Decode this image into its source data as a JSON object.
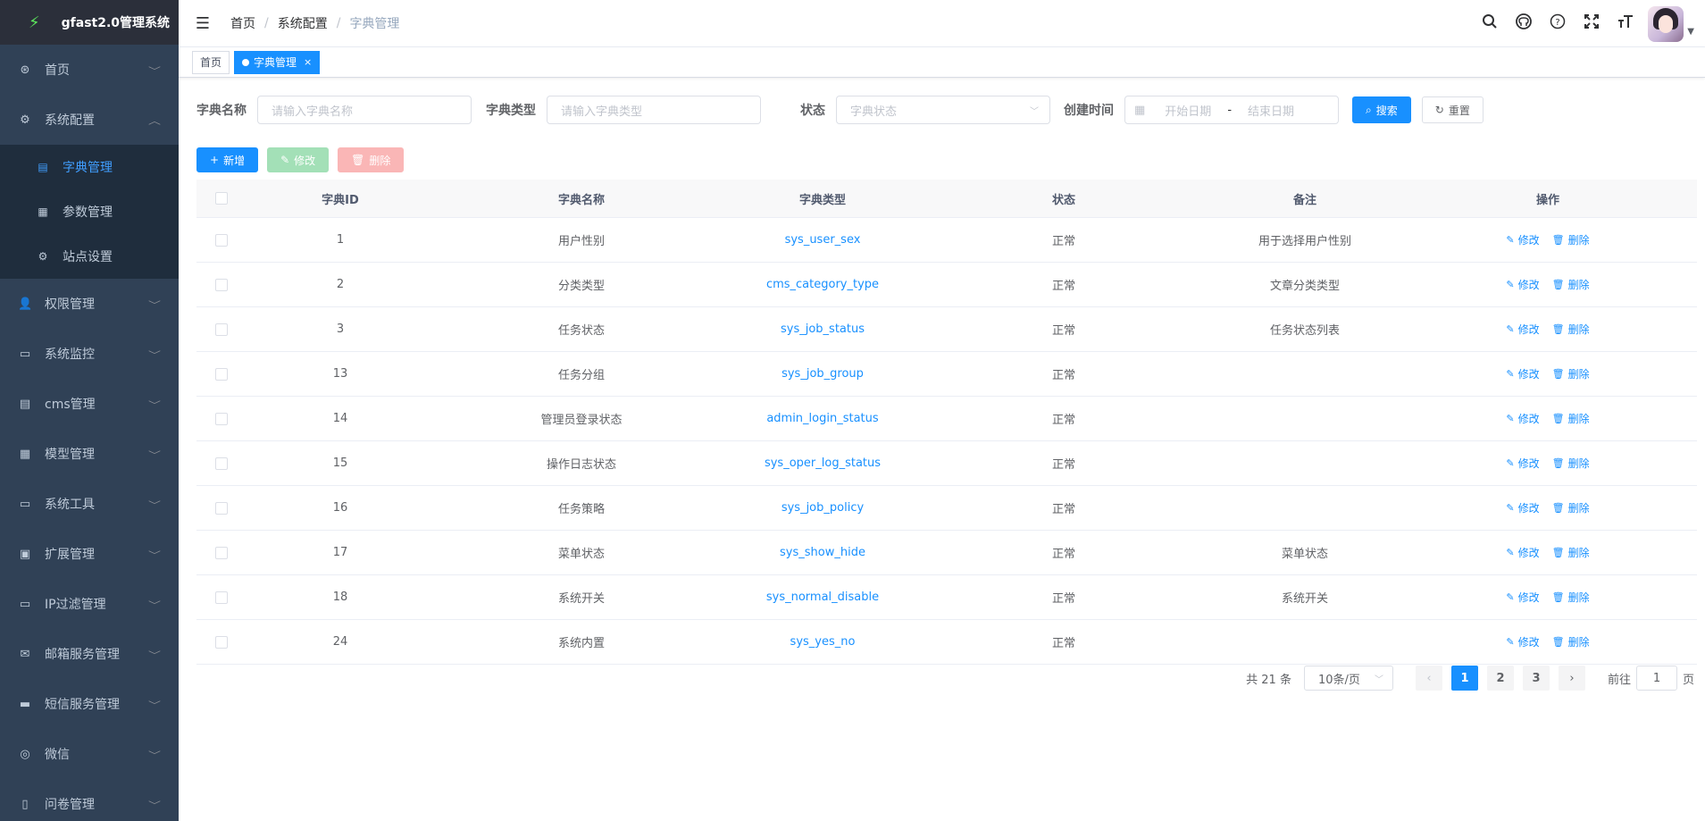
{
  "app": {
    "title": "gfast2.0管理系统"
  },
  "sidebar": {
    "items": [
      {
        "label": "首页",
        "icon": "dashboard-icon",
        "glyph": "⊛"
      },
      {
        "label": "系统配置",
        "icon": "gear-icon",
        "glyph": "⚙",
        "expanded": true,
        "children": [
          {
            "label": "字典管理",
            "icon": "dict-icon",
            "glyph": "▤",
            "active": true
          },
          {
            "label": "参数管理",
            "icon": "param-icon",
            "glyph": "▦"
          },
          {
            "label": "站点设置",
            "icon": "gear-icon",
            "glyph": "⚙"
          }
        ]
      },
      {
        "label": "权限管理",
        "icon": "user-icon",
        "glyph": "👤"
      },
      {
        "label": "系统监控",
        "icon": "monitor-icon",
        "glyph": "▭"
      },
      {
        "label": "cms管理",
        "icon": "document-icon",
        "glyph": "▤"
      },
      {
        "label": "模型管理",
        "icon": "grid-icon",
        "glyph": "▦"
      },
      {
        "label": "系统工具",
        "icon": "tools-icon",
        "glyph": "▭"
      },
      {
        "label": "扩展管理",
        "icon": "extension-icon",
        "glyph": "▣"
      },
      {
        "label": "IP过滤管理",
        "icon": "briefcase-icon",
        "glyph": "▭"
      },
      {
        "label": "邮箱服务管理",
        "icon": "mail-icon",
        "glyph": "✉"
      },
      {
        "label": "短信服务管理",
        "icon": "message-icon",
        "glyph": "▬"
      },
      {
        "label": "微信",
        "icon": "wechat-icon",
        "glyph": "◎"
      },
      {
        "label": "问卷管理",
        "icon": "book-icon",
        "glyph": "▯"
      }
    ]
  },
  "navbar": {
    "breadcrumb": [
      "首页",
      "系统配置",
      "字典管理"
    ],
    "icons": [
      "search-icon",
      "github-icon",
      "help-icon",
      "fullscreen-icon",
      "font-size-icon"
    ]
  },
  "tags": [
    {
      "label": "首页",
      "active": false
    },
    {
      "label": "字典管理",
      "active": true,
      "close": "×"
    }
  ],
  "search": {
    "dict_name_label": "字典名称",
    "dict_name_placeholder": "请输入字典名称",
    "dict_type_label": "字典类型",
    "dict_type_placeholder": "请输入字典类型",
    "status_label": "状态",
    "status_placeholder": "字典状态",
    "created_label": "创建时间",
    "start_placeholder": "开始日期",
    "range_sep": "-",
    "end_placeholder": "结束日期",
    "search_btn": "搜索",
    "reset_btn": "重置"
  },
  "toolbar": {
    "add": "新增",
    "edit": "修改",
    "delete": "删除"
  },
  "table": {
    "headers": [
      "字典ID",
      "字典名称",
      "字典类型",
      "状态",
      "备注",
      "操作"
    ],
    "edit_label": "修改",
    "delete_label": "删除",
    "rows": [
      {
        "id": "1",
        "name": "用户性别",
        "type": "sys_user_sex",
        "status": "正常",
        "remark": "用于选择用户性别"
      },
      {
        "id": "2",
        "name": "分类类型",
        "type": "cms_category_type",
        "status": "正常",
        "remark": "文章分类类型"
      },
      {
        "id": "3",
        "name": "任务状态",
        "type": "sys_job_status",
        "status": "正常",
        "remark": "任务状态列表"
      },
      {
        "id": "13",
        "name": "任务分组",
        "type": "sys_job_group",
        "status": "正常",
        "remark": ""
      },
      {
        "id": "14",
        "name": "管理员登录状态",
        "type": "admin_login_status",
        "status": "正常",
        "remark": ""
      },
      {
        "id": "15",
        "name": "操作日志状态",
        "type": "sys_oper_log_status",
        "status": "正常",
        "remark": ""
      },
      {
        "id": "16",
        "name": "任务策略",
        "type": "sys_job_policy",
        "status": "正常",
        "remark": ""
      },
      {
        "id": "17",
        "name": "菜单状态",
        "type": "sys_show_hide",
        "status": "正常",
        "remark": "菜单状态"
      },
      {
        "id": "18",
        "name": "系统开关",
        "type": "sys_normal_disable",
        "status": "正常",
        "remark": "系统开关"
      },
      {
        "id": "24",
        "name": "系统内置",
        "type": "sys_yes_no",
        "status": "正常",
        "remark": ""
      }
    ]
  },
  "pagination": {
    "total": "共 21 条",
    "page_size": "10条/页",
    "pages": [
      "1",
      "2",
      "3"
    ],
    "current": "1",
    "goto_prefix": "前往",
    "goto_value": "1",
    "goto_suffix": "页"
  },
  "colors": {
    "primary": "#1890ff",
    "sidebar_bg": "#304156",
    "logo_bg": "#2b2f3a"
  }
}
